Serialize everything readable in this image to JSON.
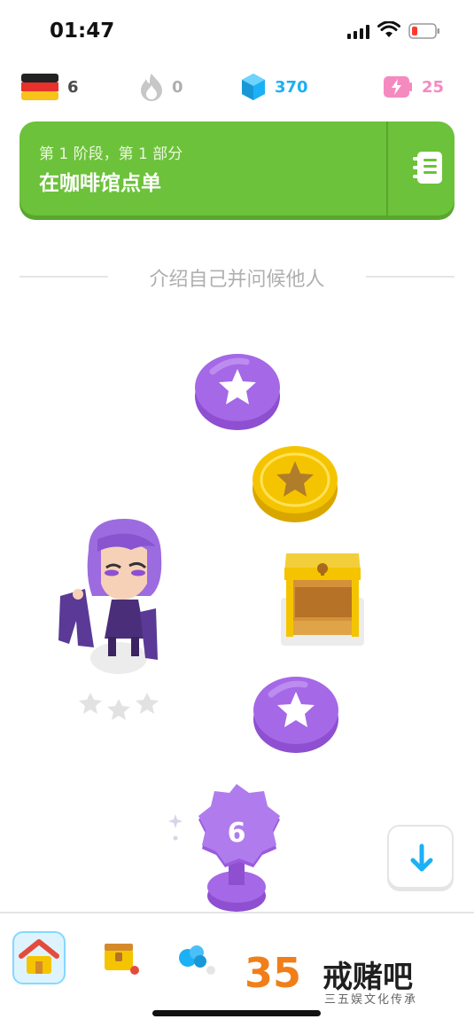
{
  "status_bar": {
    "time": "01:47"
  },
  "stats": {
    "course_flag_icon": "germany-flag-icon",
    "course_count": "6",
    "streak_icon": "flame-icon",
    "streak": "0",
    "gems_icon": "gem-icon",
    "gems": "370",
    "energy_icon": "energy-battery-icon",
    "energy": "25"
  },
  "unit_banner": {
    "subtitle": "第 1 阶段，第 1 部分",
    "title": "在咖啡馆点单",
    "guidebook_icon": "guidebook-icon"
  },
  "section_header": "介绍自己并问候他人",
  "path": {
    "nodes": [
      {
        "type": "lesson",
        "state": "purple",
        "icon": "star-icon"
      },
      {
        "type": "lesson",
        "state": "gold",
        "icon": "star-icon"
      },
      {
        "type": "chest",
        "icon": "treasure-chest-icon"
      },
      {
        "type": "lesson",
        "state": "purple",
        "icon": "star-icon"
      },
      {
        "type": "level-badge",
        "label": "6"
      }
    ]
  },
  "colors": {
    "green": "#6cc23a",
    "purple": "#a568e6",
    "gold": "#f5c400",
    "blue": "#1cb0f6",
    "pink": "#f58ac0"
  },
  "tabs": [
    {
      "name": "home",
      "icon": "home-icon",
      "active": true
    },
    {
      "name": "treasure",
      "icon": "treasure-icon"
    },
    {
      "name": "leaderboard",
      "icon": "leaderboard-icon"
    }
  ],
  "watermark": {
    "number": "35",
    "title": "戒赌吧",
    "subtitle": "三五娱文化传承"
  }
}
